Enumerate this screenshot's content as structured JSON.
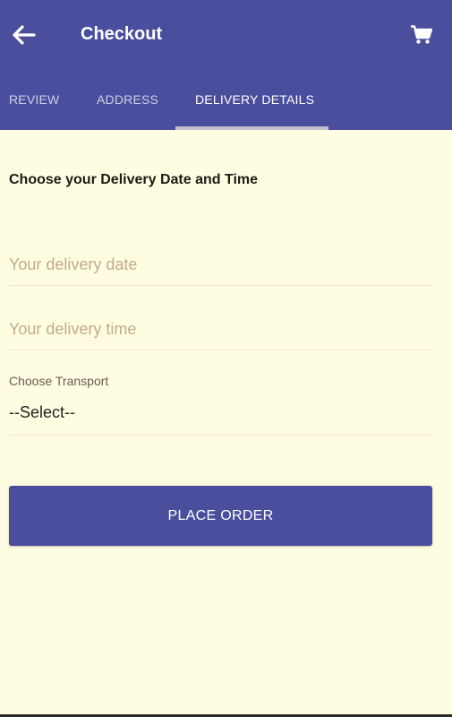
{
  "appbar": {
    "title": "Checkout",
    "back_icon": "arrow-left-icon",
    "cart_icon": "shopping-cart-icon",
    "background_color": "#4a4e9d"
  },
  "tabs": [
    {
      "label": "REVIEW",
      "active": false
    },
    {
      "label": "ADDRESS",
      "active": false
    },
    {
      "label": "DELIVERY DETAILS",
      "active": true
    }
  ],
  "form": {
    "section_title": "Choose your Delivery Date and Time",
    "date_placeholder": "Your delivery date",
    "time_placeholder": "Your delivery time",
    "transport_label": "Choose Transport",
    "transport_selected": "--Select--"
  },
  "actions": {
    "place_order_label": "PLACE ORDER"
  },
  "colors": {
    "page_background": "#fffde1",
    "accent": "#4a4e9d",
    "placeholder_text": "#c2aa8c"
  }
}
